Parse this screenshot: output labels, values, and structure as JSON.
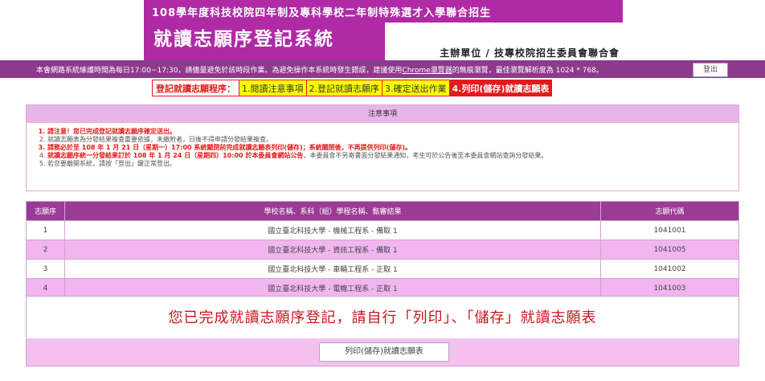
{
  "header": {
    "subtitle": "108學年度科技校院四年制及專科學校二年制特殊選才入學聯合招生",
    "title": "就讀志願序登記系統",
    "organizer": "主辦單位 / 技專校院招生委員會聯合會",
    "brand_color": "#b02aa6"
  },
  "notice_bar": {
    "text_before_link": "本會網路系統維護時間為每日17:00~17:30，請儘量避免於該時段作業。為避免操作本系統時發生錯誤，建議使用",
    "link_text": "Chrome瀏覽器",
    "text_after_link": "的無痕瀏覽，最佳瀏覽解析度為 1024 * 768。",
    "logout_label": "登出"
  },
  "steps": {
    "lead": "登記就讀志願程序：",
    "items": [
      "1.閱讀注意事項",
      "2.登記就讀志願序",
      "3.確定送出作業",
      "4.列印(儲存)就讀志願表"
    ],
    "active_index": 3
  },
  "notes": {
    "header": "注意事項",
    "items": [
      "請注意！您已完成登記就讀志願序確定送出。",
      "就讀志願表為分發結果複查重要依據，未繳附者，日後不得申請分發結果複查。",
      "請務必於至 108 年 1 月 21 日（星期一）17:00 系統關閉前完成就讀志願表列印(儲存)；系統關閉後，不再提供列印(儲存)。",
      "就讀志願序統一分發結果訂於 108 年 1 月 24 日（星期四）10:00 於本委員會網站公告，本委員會不另寄書面分發結果通知，考生可於公告後至本委員會網站查詢分發結果。",
      "若您要離開系統，請按「登出」鍵正常登出。"
    ],
    "item4_red_part": "就讀志願序統一分發結果訂於 108 年 1 月 24 日（星期四）10:00 於本委員會網站公告",
    "item4_rest": "，本委員會不另寄書面分發結果通知，考生可於公告後至本委員會網站查詢分發結果。"
  },
  "table": {
    "headers": [
      "志願序",
      "學校名稱、系科（組）學程名稱、甄審結果",
      "志願代碼"
    ],
    "rows": [
      {
        "order": "1",
        "name": "國立臺北科技大學 - 機械工程系 - 備取 1",
        "code": "1041001"
      },
      {
        "order": "2",
        "name": "國立臺北科技大學 - 資訊工程系 - 備取 1",
        "code": "1041005"
      },
      {
        "order": "3",
        "name": "國立臺北科技大學 - 車輛工程系 - 正取 1",
        "code": "1041002"
      },
      {
        "order": "4",
        "name": "國立臺北科技大學 - 電機工程系 - 正取 1",
        "code": "1041003"
      }
    ]
  },
  "finish": {
    "message": "您已完成就讀志願序登記，請自行「列印」、「儲存」就讀志願表",
    "print_button": "列印(儲存)就讀志願表"
  }
}
